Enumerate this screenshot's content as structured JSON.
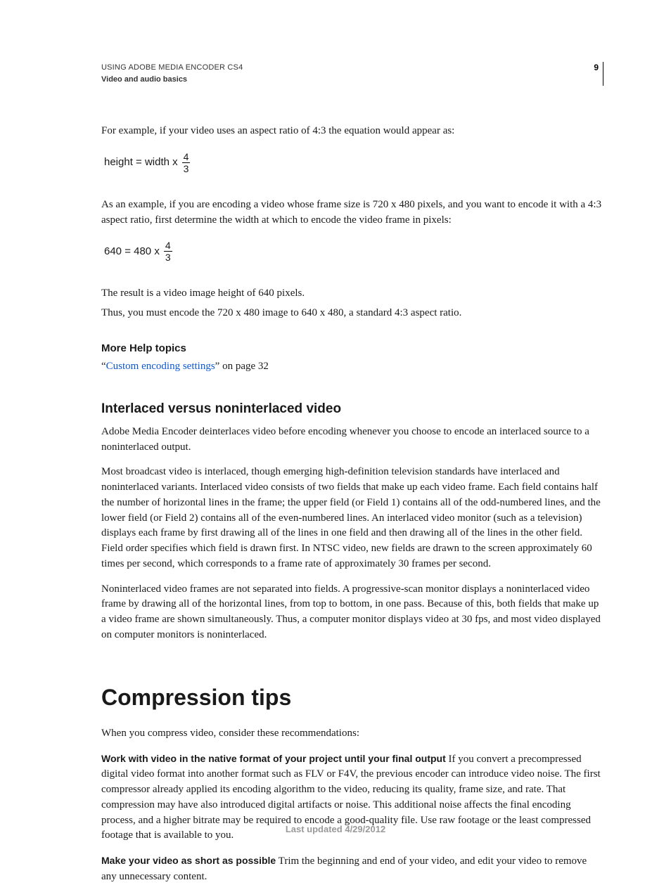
{
  "header": {
    "line1": "USING ADOBE MEDIA ENCODER CS4",
    "line2": "Video and audio basics",
    "page_number": "9"
  },
  "intro": {
    "p1": "For example, if your video uses an aspect ratio of 4:3 the equation would appear as:",
    "formula1_lhs": "height = width x",
    "formula_num": "4",
    "formula_den": "3",
    "p2": "As an example, if you are encoding a video whose frame size is 720 x 480 pixels, and you want to encode it with a 4:3 aspect ratio, first determine the width at which to encode the video frame in pixels:",
    "formula2_lhs": "640 = 480 x",
    "p3": "The result is a video image height of 640 pixels.",
    "p4": "Thus, you must encode the 720 x 480 image to 640 x 480, a standard 4:3 aspect ratio."
  },
  "more_help": {
    "heading": "More Help topics",
    "quote_open": "“",
    "link_text": "Custom encoding settings",
    "quote_close_text": "” on page 32"
  },
  "interlaced": {
    "heading": "Interlaced versus noninterlaced video",
    "p1": "Adobe Media Encoder deinterlaces video before encoding whenever you choose to encode an interlaced source to a noninterlaced output.",
    "p2": "Most broadcast video is interlaced, though emerging high-definition television standards have interlaced and noninterlaced variants. Interlaced video consists of two fields that make up each video frame. Each field contains half the number of horizontal lines in the frame; the upper field (or Field 1) contains all of the odd-numbered lines, and the lower field (or Field 2) contains all of the even-numbered lines. An interlaced video monitor (such as a television) displays each frame by first drawing all of the lines in one field and then drawing all of the lines in the other field. Field order specifies which field is drawn first. In NTSC video, new fields are drawn to the screen approximately 60 times per second, which corresponds to a frame rate of approximately 30 frames per second.",
    "p3": "Noninterlaced video frames are not separated into fields. A progressive-scan monitor displays a noninterlaced video frame by drawing all of the horizontal lines, from top to bottom, in one pass. Because of this, both fields that make up a video frame are shown simultaneously. Thus, a computer monitor displays video at 30 fps, and most video displayed on computer monitors is noninterlaced."
  },
  "compression": {
    "heading": "Compression tips",
    "p1": "When you compress video, consider these recommendations:",
    "tip1_runin": "Work with video in the native format of your project until your final output",
    "tip1_body": "  If you convert a precompressed digital video format into another format such as FLV or F4V, the previous encoder can introduce video noise. The first compressor already applied its encoding algorithm to the video, reducing its quality, frame size, and rate. That compression may have also introduced digital artifacts or noise. This additional noise affects the final encoding process, and a higher bitrate may be required to encode a good-quality file. Use raw footage or the least compressed footage that is available to you.",
    "tip2_runin": "Make your video as short as possible",
    "tip2_body": "  Trim the beginning and end of your video, and edit your video to remove any unnecessary content."
  },
  "footer": "Last updated 4/29/2012"
}
